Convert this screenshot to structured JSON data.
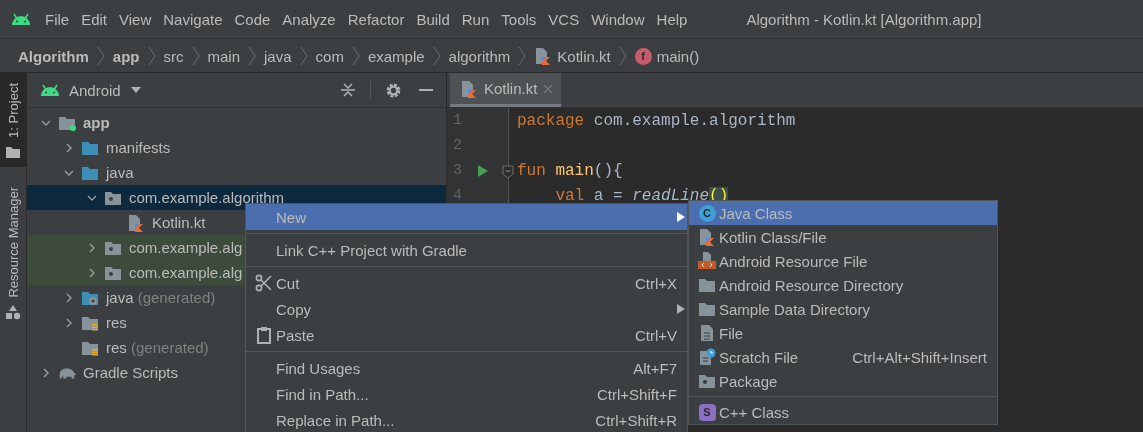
{
  "menu_bar": {
    "items": [
      {
        "label": "File"
      },
      {
        "label": "Edit"
      },
      {
        "label": "View"
      },
      {
        "label": "Navigate"
      },
      {
        "label": "Code"
      },
      {
        "label": "Analyze"
      },
      {
        "label": "Refactor"
      },
      {
        "label": "Build"
      },
      {
        "label": "Run"
      },
      {
        "label": "Tools"
      },
      {
        "label": "VCS"
      },
      {
        "label": "Window"
      },
      {
        "label": "Help"
      }
    ],
    "title": "Algorithm - Kotlin.kt [Algorithm.app]"
  },
  "breadcrumbs": [
    {
      "label": "Algorithm",
      "kind": "project"
    },
    {
      "label": "app",
      "kind": "module"
    },
    {
      "label": "src",
      "kind": "folder"
    },
    {
      "label": "main",
      "kind": "folder"
    },
    {
      "label": "java",
      "kind": "folder"
    },
    {
      "label": "com",
      "kind": "folder"
    },
    {
      "label": "example",
      "kind": "folder"
    },
    {
      "label": "algorithm",
      "kind": "folder"
    },
    {
      "label": "Kotlin.kt",
      "kind": "kotlin-file"
    },
    {
      "label": "main()",
      "kind": "function",
      "badge": "f"
    }
  ],
  "tool_stripe": [
    {
      "label": "1: Project",
      "kind": "project",
      "selected": true
    },
    {
      "label": "Resource Manager",
      "kind": "resources",
      "selected": false
    }
  ],
  "project_panel": {
    "view": "Android",
    "tree": [
      {
        "label": "app",
        "kind": "module",
        "expanded": true,
        "selected": false,
        "children": [
          {
            "label": "manifests",
            "kind": "source-folder",
            "expanded": false,
            "selected": false
          },
          {
            "label": "java",
            "kind": "source-folder",
            "expanded": true,
            "selected": false,
            "children": [
              {
                "label": "com.example.algorithm",
                "kind": "package",
                "expanded": true,
                "selected": true,
                "children": [
                  {
                    "label": "Kotlin.kt",
                    "kind": "kotlin-file",
                    "selected": false
                  }
                ]
              },
              {
                "label": "com.example.alg",
                "kind": "test-package",
                "expanded": false,
                "selected": false
              },
              {
                "label": "com.example.alg",
                "kind": "test-package",
                "expanded": false,
                "selected": false
              }
            ]
          },
          {
            "label": "java",
            "suffix": "(generated)",
            "kind": "generated-folder",
            "expanded": false,
            "selected": false
          },
          {
            "label": "res",
            "kind": "res-folder",
            "expanded": false,
            "selected": false
          },
          {
            "label": "res",
            "suffix": "(generated)",
            "kind": "res-folder",
            "selected": false
          }
        ]
      },
      {
        "label": "Gradle Scripts",
        "kind": "gradle",
        "expanded": false,
        "selected": false
      }
    ]
  },
  "editor": {
    "tabs": [
      {
        "label": "Kotlin.kt",
        "selected": true
      }
    ],
    "lines": [
      {
        "number": "1",
        "run": false,
        "fold": false,
        "tokens": [
          {
            "text": "package",
            "kind": "keyword"
          },
          {
            "text": " com.example.algorithm",
            "kind": "plain"
          }
        ]
      },
      {
        "number": "2",
        "run": false,
        "fold": false
      },
      {
        "number": "3",
        "run": true,
        "fold": true,
        "tokens": [
          {
            "text": "fun",
            "kind": "keyword"
          },
          {
            "text": " main",
            "kind": "declaration"
          },
          {
            "text": "(){",
            "kind": "plain"
          }
        ]
      },
      {
        "number": "4",
        "run": false,
        "fold": false,
        "tokens": [
          {
            "text": "    val",
            "kind": "keyword"
          },
          {
            "text": " a = ",
            "kind": "plain"
          },
          {
            "text": "readLine",
            "kind": "call"
          },
          {
            "text": "()",
            "kind": "brace-match"
          }
        ]
      }
    ]
  },
  "context_menu": {
    "items": [
      {
        "kind": "plain",
        "label": "New",
        "selected": true,
        "submenu": true
      },
      {
        "kind": "separator"
      },
      {
        "kind": "plain",
        "label": "Link C++ Project with Gradle",
        "selected": false,
        "submenu": false
      },
      {
        "kind": "separator"
      },
      {
        "kind": "cut",
        "label": "Cut",
        "shortcut": "Ctrl+X",
        "selected": false,
        "submenu": false
      },
      {
        "kind": "plain",
        "label": "Copy",
        "selected": false,
        "submenu": true
      },
      {
        "kind": "paste",
        "label": "Paste",
        "shortcut": "Ctrl+V",
        "selected": false,
        "submenu": false
      },
      {
        "kind": "separator"
      },
      {
        "kind": "plain",
        "label": "Find Usages",
        "shortcut": "Alt+F7",
        "selected": false,
        "submenu": false
      },
      {
        "kind": "plain",
        "label": "Find in Path...",
        "shortcut": "Ctrl+Shift+F",
        "selected": false,
        "submenu": false
      },
      {
        "kind": "plain",
        "label": "Replace in Path...",
        "shortcut": "Ctrl+Shift+R",
        "selected": false,
        "submenu": false
      }
    ]
  },
  "new_submenu": {
    "items": [
      {
        "kind": "java-class",
        "badge": "C",
        "label": "Java Class",
        "selected": true,
        "submenu": false
      },
      {
        "kind": "kotlin-file",
        "label": "Kotlin Class/File",
        "selected": false,
        "submenu": false
      },
      {
        "kind": "resource-file",
        "label": "Android Resource File",
        "selected": false,
        "submenu": false
      },
      {
        "kind": "directory",
        "label": "Android Resource Directory",
        "selected": false,
        "submenu": false
      },
      {
        "kind": "directory",
        "label": "Sample Data Directory",
        "selected": false,
        "submenu": false
      },
      {
        "kind": "file",
        "label": "File",
        "selected": false,
        "submenu": false
      },
      {
        "kind": "scratch-file",
        "label": "Scratch File",
        "shortcut": "Ctrl+Alt+Shift+Insert",
        "selected": false,
        "submenu": false
      },
      {
        "kind": "package",
        "label": "Package",
        "selected": false,
        "submenu": false
      },
      {
        "kind": "separator"
      },
      {
        "kind": "cpp-class",
        "badge": "S",
        "label": "C++ Class",
        "selected": false,
        "submenu": false
      }
    ]
  }
}
